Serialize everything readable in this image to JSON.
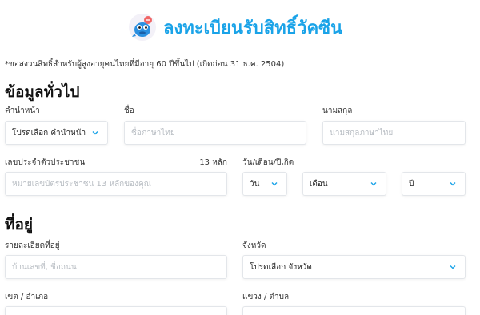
{
  "header": {
    "title": "ลงทะเบียนรับสิทธิ์วัคซีน"
  },
  "note": "*ขอสงวนสิทธิ์สำหรับผู้สูงอายุคนไทยที่มีอายุ 60 ปีขึ้นไป (เกิดก่อน 31 ธ.ค. 2504)",
  "general": {
    "section_title": "ข้อมูลทั่วไป",
    "prefix": {
      "label": "คำนำหน้า",
      "value": "โปรดเลือก คำนำหน้า"
    },
    "first_name": {
      "label": "ชื่อ",
      "placeholder": "ชื่อภาษาไทย"
    },
    "last_name": {
      "label": "นามสกุล",
      "placeholder": "นามสกุลภาษาไทย"
    },
    "id_number": {
      "label": "เลขประจำตัวประชาชน",
      "hint": "13 หลัก",
      "placeholder": "หมายเลขบัตรประชาชน 13 หลักของคุณ"
    },
    "birth_date": {
      "label": "วัน/เดือน/ปีเกิด",
      "day": "วัน",
      "month": "เดือน",
      "year": "ปี"
    }
  },
  "address": {
    "section_title": "ที่อยู่",
    "detail": {
      "label": "รายละเอียดที่อยู่",
      "placeholder": "บ้านเลขที่, ชื่อถนน"
    },
    "province": {
      "label": "จังหวัด",
      "value": "โปรดเลือก จังหวัด"
    },
    "district": {
      "label": "เขต / อำเภอ"
    },
    "subdistrict": {
      "label": "แขวง / ตำบล"
    }
  },
  "colors": {
    "accent": "#1aa3e8",
    "chevron": "#1aa3e8"
  }
}
